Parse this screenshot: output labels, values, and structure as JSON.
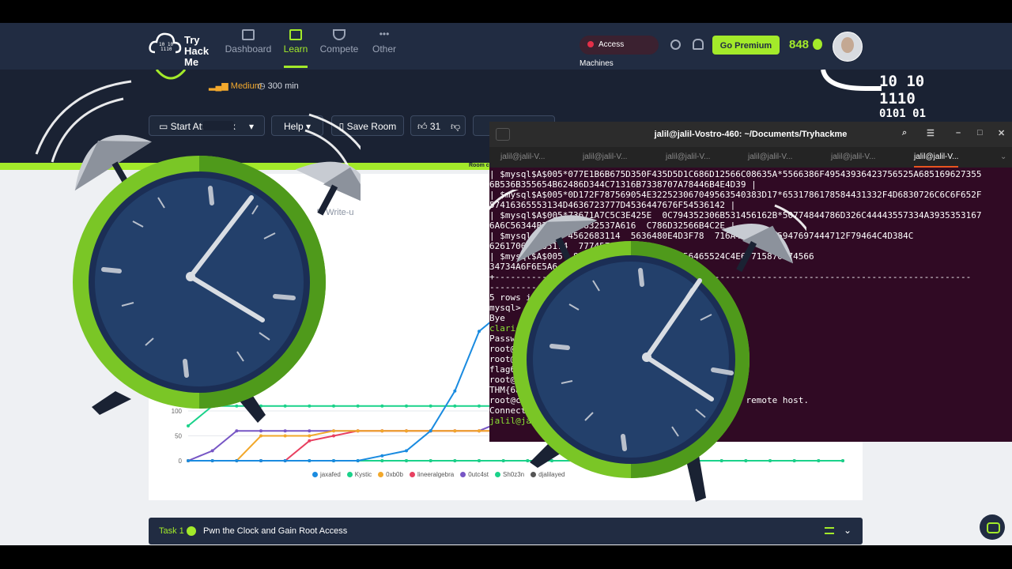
{
  "nav": {
    "logo_text": "Try Hack Me",
    "logo_bits": "10 10 1110 0101 01",
    "items": [
      {
        "label": "Dashboard",
        "active": false
      },
      {
        "label": "Learn",
        "active": true
      },
      {
        "label": "Compete",
        "active": false
      },
      {
        "label": "Other",
        "active": false
      }
    ],
    "access_label": "Access Machines",
    "premium_label": "Go Premium",
    "streak": "848"
  },
  "room": {
    "difficulty": "Medium",
    "duration": "300 min",
    "buttons": {
      "start": "Start AttackBox",
      "help": "Help",
      "save": "Save Room",
      "likes": "31"
    },
    "label": "Room c",
    "writeup": "Write-u",
    "bits": [
      "10  10",
      "1110",
      "0101  01"
    ]
  },
  "chart_data": {
    "type": "line",
    "title": "",
    "xlabel": "",
    "ylabel": "",
    "ylim": [
      0,
      500
    ],
    "yticks": [
      0,
      50,
      100
    ],
    "series": [
      {
        "name": "jaxafed",
        "color": "#1a8be0",
        "values": [
          0,
          0,
          0,
          0,
          0,
          0,
          0,
          0,
          10,
          20,
          60,
          140,
          260,
          300,
          300,
          300,
          300,
          300,
          300,
          300,
          300,
          300,
          380,
          380,
          380,
          380,
          380,
          380
        ]
      },
      {
        "name": "Kystic",
        "color": "#1ad28a",
        "values": [
          70,
          110,
          110,
          110,
          110,
          110,
          110,
          110,
          110,
          110,
          110,
          110,
          110,
          110,
          110,
          110,
          110,
          110,
          110,
          110,
          110,
          140,
          140,
          140,
          140,
          170,
          180,
          180
        ]
      },
      {
        "name": "0xb0b",
        "color": "#f2a82b",
        "values": [
          0,
          0,
          0,
          50,
          50,
          50,
          60,
          60,
          60,
          60,
          60,
          60,
          60,
          60,
          60,
          60,
          60,
          60,
          60,
          80,
          100,
          120,
          150,
          150,
          150,
          150,
          150,
          150
        ]
      },
      {
        "name": "lineeralgebra",
        "color": "#e84060",
        "values": [
          0,
          0,
          0,
          0,
          0,
          40,
          50,
          60,
          60,
          60,
          60,
          60,
          60,
          60,
          60,
          60,
          60,
          60,
          60,
          60,
          60,
          60,
          60,
          60,
          60,
          60,
          60,
          60
        ]
      },
      {
        "name": "0utc4st",
        "color": "#7756c5",
        "values": [
          0,
          20,
          60,
          60,
          60,
          60,
          60,
          60,
          60,
          60,
          60,
          60,
          60,
          80,
          100,
          100,
          120,
          150,
          150,
          150,
          150,
          150,
          150,
          150,
          150,
          150,
          150,
          150
        ]
      },
      {
        "name": "Sh0z3n",
        "color": "#1ad28a",
        "values": [
          0,
          0,
          0,
          0,
          0,
          0,
          0,
          0,
          0,
          0,
          0,
          0,
          0,
          0,
          0,
          0,
          0,
          0,
          0,
          0,
          0,
          0,
          0,
          0,
          0,
          0,
          0,
          0
        ]
      },
      {
        "name": "djalilayed",
        "color": "#555555",
        "values": [
          0,
          0,
          0,
          0,
          0,
          0,
          0,
          0,
          0,
          0,
          0,
          0,
          0,
          0,
          0,
          0,
          0,
          0,
          0,
          0,
          0,
          0,
          0,
          0,
          0,
          0,
          0,
          0
        ]
      }
    ]
  },
  "task": {
    "number": "Task 1",
    "title": "Pwn the Clock and Gain Root Access"
  },
  "terminal": {
    "title": "jalil@jalil-Vostro-460: ~/Documents/Tryhackme",
    "tabs": [
      "jalil@jalil-V...",
      "jalil@jalil-V...",
      "jalil@jalil-V...",
      "jalil@jalil-V...",
      "jalil@jalil-V...",
      "jalil@jalil-V..."
    ],
    "lines": [
      "| $mysql$A$005*077E1B6B675D350F435D5D1C686D12566C08635A*5566386F49543936423756525A685169627355",
      "6B536B355654B62486D344C71316B7338707A78446B4E4D39 |",
      "| $mysql$A$005*0D172F787569054E322523067049563540383D17*6531786178584431332F4D6830726C6C6F652F",
      "57416365553134D4636723777D4536447676F54536142 |",
      "| $mysql$A$005*73671A7C5C3E425E  0C794352306B531456162B*50774844786D326C44443557334A3935353167",
      "6A6C56344B35A39684832537A616  C786D32566B4C2E |",
      "| $mysql$A$005*4562683114  5636480E4D3F78  716A4E6262555947697444712F79464C4D384C",
      "626170638385174  7774576332",
      "| $mysql$A$005  8216D5A1  6B2F577851456465524C4E67715870574566",
      "34734A6F6E5A6  462E |",
      "+-------------------------------------------------------------------------------------------",
      "---------------------------------+",
      "5 rows in set",
      "",
      "mysql> exit",
      "Bye",
      "clarice@",
      "Password",
      "root@clo",
      "root@clo",
      "flag6.",
      "root@clo",
      "THM{6ad",
      "root@clo                                      by remote host.",
      "Connection",
      "jalil@jalil"
    ]
  }
}
